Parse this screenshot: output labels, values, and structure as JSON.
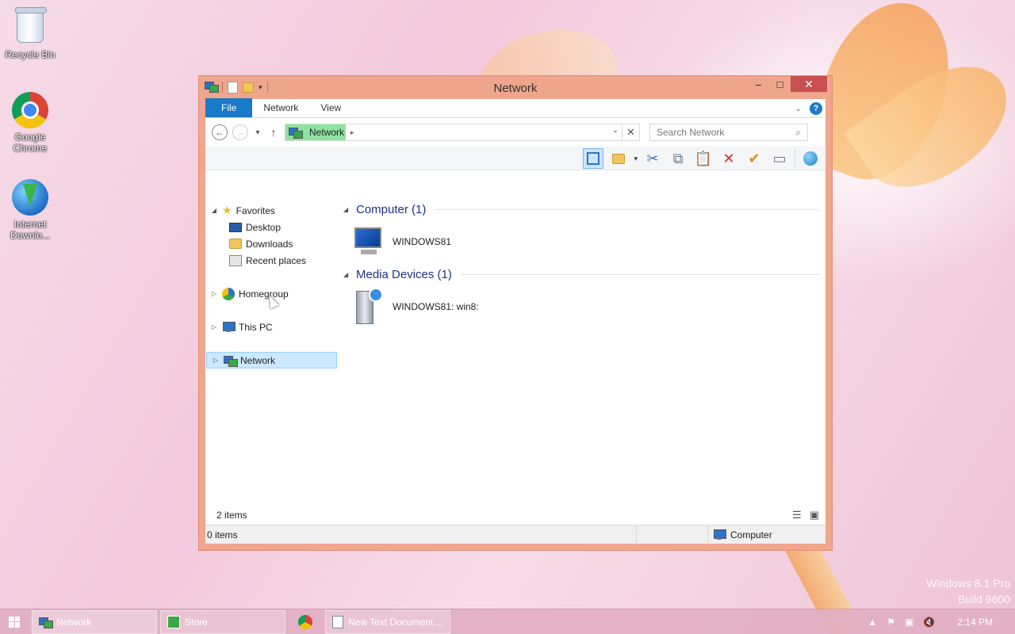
{
  "desktop": {
    "icons": [
      {
        "label": "Recycle Bin",
        "icon": "recycle-bin-icon"
      },
      {
        "label": "Google Chrome",
        "icon": "chrome-icon"
      },
      {
        "label": "Internet Downlo...",
        "icon": "internet-download-manager-icon"
      }
    ],
    "watermark": {
      "line1": "Windows 8.1 Pro",
      "line2": "Build 9600"
    }
  },
  "window": {
    "title": "Network",
    "ribbon_tabs": [
      "File",
      "Network",
      "View"
    ],
    "address": {
      "crumb": "Network"
    },
    "search": {
      "placeholder": "Search Network"
    },
    "nav": {
      "favorites": "Favorites",
      "desktop": "Desktop",
      "downloads": "Downloads",
      "recent": "Recent places",
      "homegroup": "Homegroup",
      "thispc": "This PC",
      "network": "Network"
    },
    "groups": [
      {
        "title": "Computer (1)",
        "items": [
          "WINDOWS81"
        ]
      },
      {
        "title": "Media Devices (1)",
        "items": [
          "WINDOWS81: win8:"
        ]
      }
    ],
    "item_count": "2 items",
    "status": {
      "selected": "0 items",
      "location": "Computer"
    }
  },
  "taskbar": {
    "tasks": [
      {
        "label": "Network"
      },
      {
        "label": "Store"
      },
      {
        "label": "New Text Document ..."
      }
    ],
    "clock": "2:14 PM"
  },
  "colors": {
    "accent": "#1979ca",
    "frame": "#f0a58d",
    "close": "#c75050"
  }
}
